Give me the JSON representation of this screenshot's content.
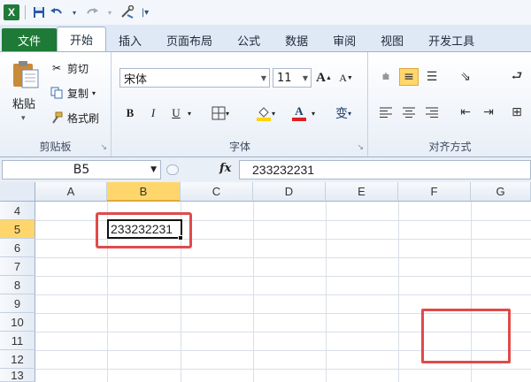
{
  "app": {
    "logo": "X"
  },
  "quick_access": {
    "save_icon": "save-icon",
    "undo_icon": "undo-icon",
    "redo_icon": "redo-icon",
    "customize_icon": "customize-icon"
  },
  "tabs": [
    {
      "label": "文件"
    },
    {
      "label": "开始"
    },
    {
      "label": "插入"
    },
    {
      "label": "页面布局"
    },
    {
      "label": "公式"
    },
    {
      "label": "数据"
    },
    {
      "label": "审阅"
    },
    {
      "label": "视图"
    },
    {
      "label": "开发工具"
    }
  ],
  "ribbon": {
    "clipboard": {
      "paste": "粘贴",
      "cut": "剪切",
      "copy": "复制",
      "format_painter": "格式刷",
      "group_label": "剪贴板"
    },
    "font": {
      "font_name": "宋体",
      "font_size": "11",
      "bold": "B",
      "italic": "I",
      "underline": "U",
      "font_color_letter": "A",
      "grow": "A",
      "shrink": "A",
      "phonetic": "变",
      "group_label": "字体"
    },
    "alignment": {
      "group_label": "对齐方式"
    }
  },
  "formula_bar": {
    "name_box": "B5",
    "fx": "fx",
    "value": "233232231"
  },
  "sheet": {
    "columns": [
      "A",
      "B",
      "C",
      "D",
      "E",
      "F",
      "G"
    ],
    "rows": [
      "4",
      "5",
      "6",
      "7",
      "8",
      "9",
      "10",
      "11",
      "12",
      "13"
    ],
    "selected_column": "B",
    "selected_row": "5",
    "cell_b5": "233232231"
  },
  "colors": {
    "file_tab": "#1e7a36",
    "selection": "#ffd66b",
    "highlight": "#e04a4a"
  }
}
